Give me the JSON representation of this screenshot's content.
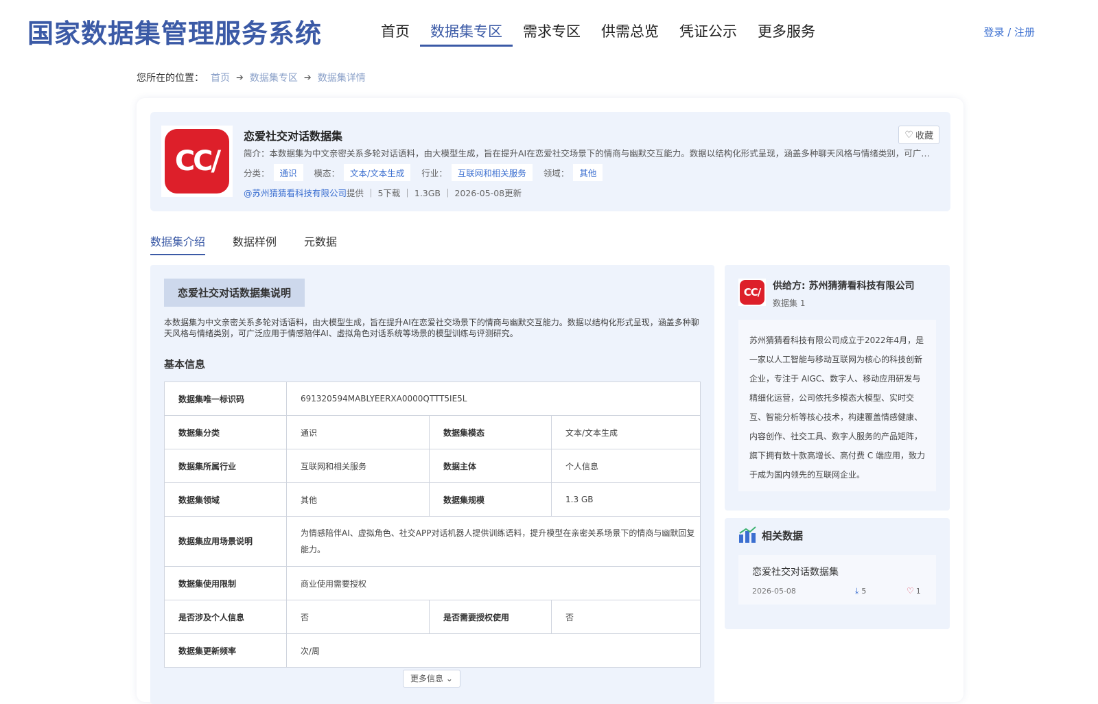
{
  "header": {
    "site_title": "国家数据集管理服务系统",
    "nav": [
      "首页",
      "数据集专区",
      "需求专区",
      "供需总览",
      "凭证公示",
      "更多服务"
    ],
    "login": "登录 / 注册"
  },
  "breadcrumb": {
    "prefix": "您所在的位置：",
    "items": [
      "首页",
      "数据集专区",
      "数据集详情"
    ]
  },
  "dataset": {
    "logo_text": "CC/",
    "title": "恋爱社交对话数据集",
    "brief": "简介：本数据集为中文亲密关系多轮对话语料，由大模型生成，旨在提升AI在恋爱社交场景下的情商与幽默交互能力。数据以结构化形式呈现，涵盖多种聊天风格与情绪类别，可广泛应用...",
    "favorite": "收藏",
    "tags": [
      {
        "label": "分类：",
        "value": "通识"
      },
      {
        "label": "模态：",
        "value": "文本/文本生成"
      },
      {
        "label": "行业：",
        "value": "互联网和相关服务"
      },
      {
        "label": "领域：",
        "value": "其他"
      }
    ],
    "provider": "@苏州猜猜看科技有限公司",
    "meta": "提供 ｜ 5下载 ｜ 1.3GB ｜ 2026-05-08更新"
  },
  "tabs": [
    "数据集介绍",
    "数据样例",
    "元数据"
  ],
  "intro": {
    "heading": "恋爱社交对话数据集说明",
    "description": "本数据集为中文亲密关系多轮对话语料，由大模型生成，旨在提升AI在恋爱社交场景下的情商与幽默交互能力。数据以结构化形式呈现，涵盖多种聊天风格与情绪类别，可广泛应用于情感陪伴AI、虚拟角色对话系统等场景的模型训练与评测研究。",
    "basic_title": "基本信息",
    "table": {
      "id_key": "数据集唯一标识码",
      "id_val": "691320594MABLYEERXA0000QTTT5IE5L",
      "cat_key": "数据集分类",
      "cat_val": "通识",
      "modal_key": "数据集模态",
      "modal_val": "文本/文本生成",
      "industry_key": "数据集所属行业",
      "industry_val": "互联网和相关服务",
      "subject_key": "数据主体",
      "subject_val": "个人信息",
      "domain_key": "数据集领域",
      "domain_val": "其他",
      "scale_key": "数据集规模",
      "scale_val": "1.3 GB",
      "scene_key": "数据集应用场景说明",
      "scene_val": "为情感陪伴AI、虚拟角色、社交APP对话机器人提供训练语料，提升模型在亲密关系场景下的情商与幽默回复能力。",
      "limit_key": "数据集使用限制",
      "limit_val": "商业使用需要授权",
      "personal_key": "是否涉及个人信息",
      "personal_val": "否",
      "auth_key": "是否需要授权使用",
      "auth_val": "否",
      "freq_key": "数据集更新频率",
      "freq_val": "次/周"
    },
    "more": "更多信息"
  },
  "supplier": {
    "logo_text": "CC/",
    "name": "供给方: 苏州猜猜看科技有限公司",
    "count": "数据集 1",
    "description": "苏州猜猜看科技有限公司成立于2022年4月，是一家以人工智能与移动互联网为核心的科技创新企业，专注于 AIGC、数字人、移动应用研发与精细化运营，公司依托多模态大模型、实时交互、智能分析等核心技术，构建覆盖情感健康、内容创作、社交工具、数字人服务的产品矩阵，旗下拥有数十款高增长、高付费 C 端应用，致力于成为国内领先的互联网企业。"
  },
  "related": {
    "title": "相关数据",
    "items": [
      {
        "name": "恋爱社交对话数据集",
        "date": "2026-05-08",
        "downloads": "5",
        "likes": "1"
      }
    ]
  },
  "colors": {
    "brand": "#3b5aa6",
    "link": "#3b6fd0",
    "logo_red": "#dd1f2a",
    "panel_bg": "#eef3fc"
  }
}
